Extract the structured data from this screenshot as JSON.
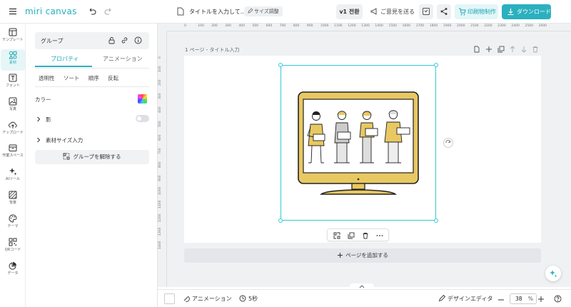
{
  "app": {
    "logo": "miri canvas",
    "accent": "#2bb0bf"
  },
  "header": {
    "title": "タイトルを入力して...",
    "size_badge": "サイズ調整",
    "version": "v1 전환",
    "feedback": "ご意見を送る",
    "print": "印刷物制作",
    "download": "ダウンロード"
  },
  "rail": {
    "items": [
      {
        "label": "テンプレート",
        "icon": "template-icon"
      },
      {
        "label": "素材",
        "icon": "elements-icon"
      },
      {
        "label": "フォント",
        "icon": "text-icon"
      },
      {
        "label": "写真",
        "icon": "photo-icon"
      },
      {
        "label": "アップロード",
        "icon": "upload-icon"
      },
      {
        "label": "作業スペース",
        "icon": "workspace-icon"
      },
      {
        "label": "AIツール",
        "icon": "ai-tools-icon"
      },
      {
        "label": "背景",
        "icon": "background-icon"
      },
      {
        "label": "テーマ",
        "icon": "theme-icon"
      },
      {
        "label": "QRコード",
        "icon": "qr-icon"
      },
      {
        "label": "データ",
        "icon": "data-icon"
      }
    ]
  },
  "panel": {
    "group_label": "グループ",
    "tabs": [
      "プロパティ",
      "アニメーション"
    ],
    "subtabs": [
      "透明性",
      "ソート",
      "順序",
      "反転"
    ],
    "color_label": "カラー",
    "shadow_label": "影",
    "size_label": "素材サイズ入力",
    "ungroup": "グループを解除する"
  },
  "canvas": {
    "page_label": "1 ページ - タイトル入力",
    "add_page": "ページを追加する",
    "ruler_x": [
      "0",
      "100",
      "200",
      "300",
      "400",
      "500",
      "600",
      "700",
      "800",
      "900",
      "1000",
      "1100",
      "1200",
      "1300",
      "1400",
      "1500",
      "1600",
      "1700",
      "1800",
      "1900",
      "2000",
      "2100",
      "2200",
      "2300",
      "2400",
      "2500",
      "2600"
    ],
    "ruler_y": [
      "0",
      "100",
      "200",
      "300",
      "400",
      "500",
      "600",
      "700",
      "800",
      "900",
      "1000",
      "1100",
      "1200",
      "1300",
      "1400"
    ]
  },
  "bottom": {
    "animation": "アニメーション",
    "duration": "5秒",
    "design_editor": "デザインエディタ",
    "zoom": "38",
    "zoom_unit": "%"
  }
}
